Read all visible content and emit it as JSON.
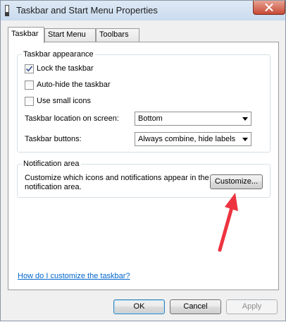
{
  "window": {
    "title": "Taskbar and Start Menu Properties",
    "icon": "taskbar-icon",
    "close_icon": "close-icon"
  },
  "tabs": [
    {
      "label": "Taskbar",
      "active": true
    },
    {
      "label": "Start Menu",
      "active": false
    },
    {
      "label": "Toolbars",
      "active": false
    }
  ],
  "appearance": {
    "title": "Taskbar appearance",
    "lock": {
      "label": "Lock the taskbar",
      "checked": true
    },
    "autohide": {
      "label": "Auto-hide the taskbar",
      "checked": false
    },
    "small_icons": {
      "label": "Use small icons",
      "checked": false
    },
    "location": {
      "label": "Taskbar location on screen:",
      "value": "Bottom"
    },
    "buttons": {
      "label": "Taskbar buttons:",
      "value": "Always combine, hide labels"
    }
  },
  "notification": {
    "title": "Notification area",
    "description": "Customize which icons and notifications appear in the notification area.",
    "customize_label": "Customize..."
  },
  "help_link": "How do I customize the taskbar?",
  "footer": {
    "ok": "OK",
    "cancel": "Cancel",
    "apply": "Apply"
  },
  "colors": {
    "annotation_arrow": "#ee3340",
    "link": "#0066cc"
  }
}
